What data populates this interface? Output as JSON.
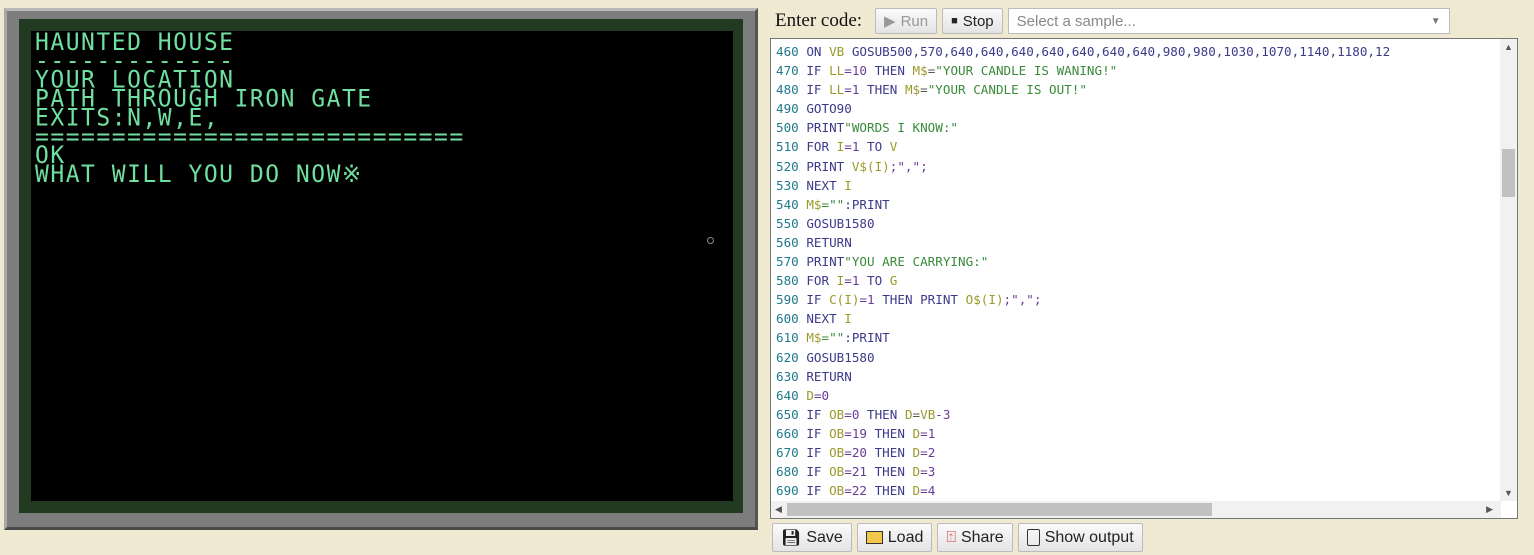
{
  "terminal": {
    "lines": [
      "HAUNTED HOUSE",
      "-------------",
      "YOUR LOCATION",
      "PATH THROUGH IRON GATE",
      "EXITS:N,W,E,",
      "============================",
      "OK",
      "WHAT WILL YOU DO NOW※"
    ]
  },
  "toolbar": {
    "label": "Enter code:",
    "run": "Run",
    "stop": "Stop",
    "select_placeholder": "Select a sample..."
  },
  "code": [
    [
      [
        "460",
        "ln"
      ],
      [
        " ON ",
        "kw"
      ],
      [
        "VB",
        "var"
      ],
      [
        " GOSUB500,570,640,640,640,640,640,640,640,980,980,1030,1070,1140,1180,12",
        "kw"
      ]
    ],
    [
      [
        "470",
        "ln"
      ],
      [
        " IF ",
        "kw"
      ],
      [
        "LL",
        "var"
      ],
      [
        "=10",
        "num"
      ],
      [
        " THEN ",
        "kw"
      ],
      [
        "M$",
        "var"
      ],
      [
        "=",
        "op"
      ],
      [
        "\"YOUR CANDLE IS WANING!\"",
        "str"
      ]
    ],
    [
      [
        "480",
        "ln"
      ],
      [
        " IF ",
        "kw"
      ],
      [
        "LL",
        "var"
      ],
      [
        "=1",
        "num"
      ],
      [
        " THEN ",
        "kw"
      ],
      [
        "M$",
        "var"
      ],
      [
        "=",
        "op"
      ],
      [
        "\"YOUR CANDLE IS OUT!\"",
        "str"
      ]
    ],
    [
      [
        "490",
        "ln"
      ],
      [
        " GOTO90",
        "kw"
      ]
    ],
    [
      [
        "500",
        "ln"
      ],
      [
        " PRINT",
        "kw"
      ],
      [
        "\"WORDS I KNOW:\"",
        "str"
      ]
    ],
    [
      [
        "510",
        "ln"
      ],
      [
        " FOR ",
        "kw"
      ],
      [
        "I",
        "var"
      ],
      [
        "=1",
        "num"
      ],
      [
        " TO ",
        "kw"
      ],
      [
        "V",
        "var"
      ]
    ],
    [
      [
        "520",
        "ln"
      ],
      [
        " PRINT ",
        "kw"
      ],
      [
        "V$(I)",
        "var"
      ],
      [
        ";\",\";",
        "num"
      ]
    ],
    [
      [
        "530",
        "ln"
      ],
      [
        " NEXT ",
        "kw"
      ],
      [
        "I",
        "var"
      ]
    ],
    [
      [
        "540",
        "ln"
      ],
      [
        " ",
        "kw"
      ],
      [
        "M$",
        "var"
      ],
      [
        "=\"\"",
        "str"
      ],
      [
        ":PRINT",
        "kw"
      ]
    ],
    [
      [
        "550",
        "ln"
      ],
      [
        " GOSUB1580",
        "kw"
      ]
    ],
    [
      [
        "560",
        "ln"
      ],
      [
        " RETURN",
        "kw"
      ]
    ],
    [
      [
        "570",
        "ln"
      ],
      [
        " PRINT",
        "kw"
      ],
      [
        "\"YOU ARE CARRYING:\"",
        "str"
      ]
    ],
    [
      [
        "580",
        "ln"
      ],
      [
        " FOR ",
        "kw"
      ],
      [
        "I",
        "var"
      ],
      [
        "=1",
        "num"
      ],
      [
        " TO ",
        "kw"
      ],
      [
        "G",
        "var"
      ]
    ],
    [
      [
        "590",
        "ln"
      ],
      [
        " IF ",
        "kw"
      ],
      [
        "C(I)",
        "var"
      ],
      [
        "=1",
        "num"
      ],
      [
        " THEN PRINT ",
        "kw"
      ],
      [
        "O$(I)",
        "var"
      ],
      [
        ";\",\";",
        "num"
      ]
    ],
    [
      [
        "600",
        "ln"
      ],
      [
        " NEXT ",
        "kw"
      ],
      [
        "I",
        "var"
      ]
    ],
    [
      [
        "610",
        "ln"
      ],
      [
        " ",
        "kw"
      ],
      [
        "M$",
        "var"
      ],
      [
        "=\"\"",
        "str"
      ],
      [
        ":PRINT",
        "kw"
      ]
    ],
    [
      [
        "620",
        "ln"
      ],
      [
        " GOSUB1580",
        "kw"
      ]
    ],
    [
      [
        "630",
        "ln"
      ],
      [
        " RETURN",
        "kw"
      ]
    ],
    [
      [
        "640",
        "ln"
      ],
      [
        " ",
        "kw"
      ],
      [
        "D",
        "var"
      ],
      [
        "=0",
        "num"
      ]
    ],
    [
      [
        "650",
        "ln"
      ],
      [
        " IF ",
        "kw"
      ],
      [
        "OB",
        "var"
      ],
      [
        "=0",
        "num"
      ],
      [
        " THEN ",
        "kw"
      ],
      [
        "D",
        "var"
      ],
      [
        "=",
        "op"
      ],
      [
        "VB",
        "var"
      ],
      [
        "-3",
        "num"
      ]
    ],
    [
      [
        "660",
        "ln"
      ],
      [
        " IF ",
        "kw"
      ],
      [
        "OB",
        "var"
      ],
      [
        "=19",
        "num"
      ],
      [
        " THEN ",
        "kw"
      ],
      [
        "D",
        "var"
      ],
      [
        "=1",
        "num"
      ]
    ],
    [
      [
        "670",
        "ln"
      ],
      [
        " IF ",
        "kw"
      ],
      [
        "OB",
        "var"
      ],
      [
        "=20",
        "num"
      ],
      [
        " THEN ",
        "kw"
      ],
      [
        "D",
        "var"
      ],
      [
        "=2",
        "num"
      ]
    ],
    [
      [
        "680",
        "ln"
      ],
      [
        " IF ",
        "kw"
      ],
      [
        "OB",
        "var"
      ],
      [
        "=21",
        "num"
      ],
      [
        " THEN ",
        "kw"
      ],
      [
        "D",
        "var"
      ],
      [
        "=3",
        "num"
      ]
    ],
    [
      [
        "690",
        "ln"
      ],
      [
        " IF ",
        "kw"
      ],
      [
        "OB",
        "var"
      ],
      [
        "=22",
        "num"
      ],
      [
        " THEN ",
        "kw"
      ],
      [
        "D",
        "var"
      ],
      [
        "=4",
        "num"
      ]
    ]
  ],
  "bottom": {
    "save": "Save",
    "load": "Load",
    "share": "Share",
    "show_output": "Show output"
  }
}
